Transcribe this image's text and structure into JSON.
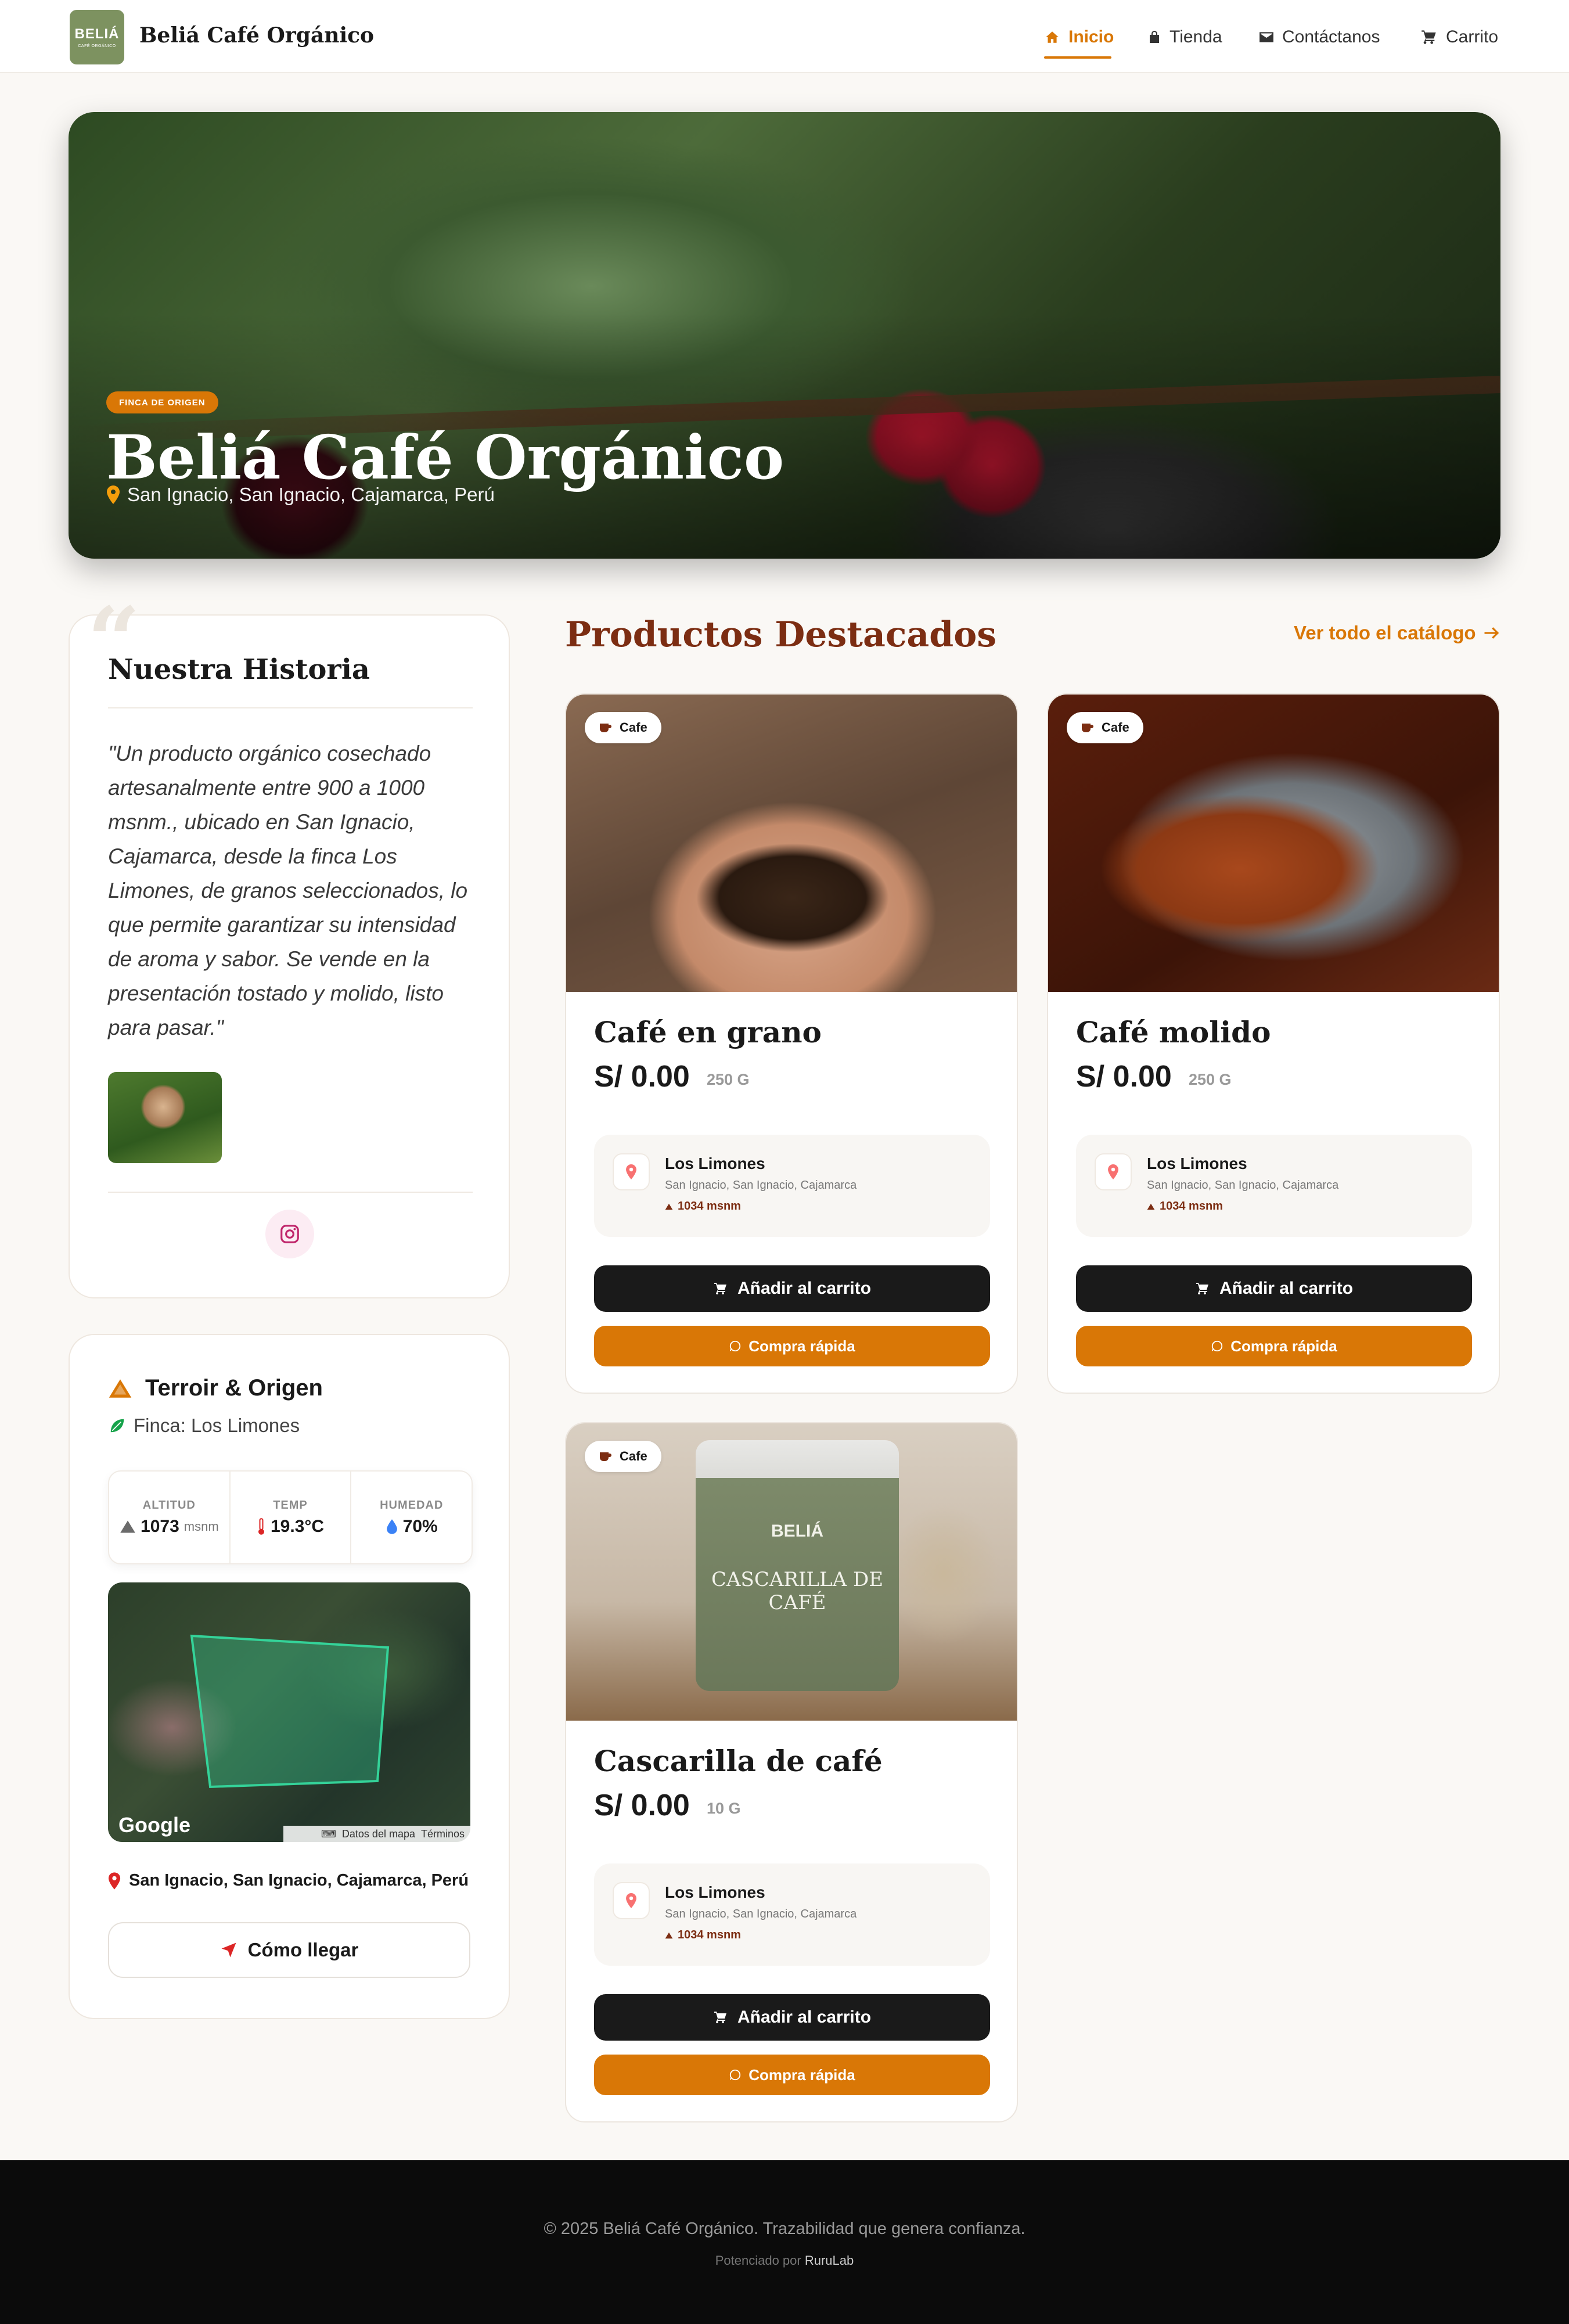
{
  "header": {
    "logo_text": "BELIÁ",
    "logo_sub": "CAFÉ ORGÁNICO",
    "brand": "Beliá Café Orgánico",
    "nav": [
      {
        "label": "Inicio",
        "icon": "home-icon",
        "active": true
      },
      {
        "label": "Tienda",
        "icon": "bag-icon",
        "active": false
      },
      {
        "label": "Contáctanos",
        "icon": "envelope-icon",
        "active": false
      },
      {
        "label": "Carrito",
        "icon": "cart-icon",
        "active": false
      }
    ]
  },
  "hero": {
    "badge": "FINCA DE ORIGEN",
    "title": "Beliá Café Orgánico",
    "location": "San Ignacio, San Ignacio, Cajamarca, Perú"
  },
  "story": {
    "title": "Nuestra Historia",
    "text": "\"Un producto orgánico cosechado artesanalmente entre 900 a 1000 msnm., ubicado en San Ignacio, Cajamarca, desde la finca Los Limones, de granos seleccionados, lo que permite garantizar su intensidad de aroma y sabor. Se vende en la presentación tostado y molido, listo para pasar.\"",
    "social_icon": "instagram-icon"
  },
  "terroir": {
    "title": "Terroir & Origen",
    "farm": "Finca: Los Limones",
    "stats": [
      {
        "label": "ALTITUD",
        "value": "1073",
        "unit": "msnm"
      },
      {
        "label": "TEMP",
        "value": "19.3°C",
        "unit": ""
      },
      {
        "label": "HUMEDAD",
        "value": "70%",
        "unit": ""
      }
    ],
    "map": {
      "logo": "Google",
      "attribution_data": "Datos del mapa",
      "attribution_terms": "Términos"
    },
    "address": "San Ignacio, San Ignacio, Cajamarca, Perú",
    "directions_label": "Cómo llegar"
  },
  "featured": {
    "title": "Productos Destacados",
    "catalog_link": "Ver todo el catálogo",
    "products": [
      {
        "category": "Cafe",
        "name": "Café en grano",
        "price": "S/ 0.00",
        "unit": "250 G",
        "farm": "Los Limones",
        "farm_location": "San Ignacio, San Ignacio, Cajamarca",
        "altitude": "1034 msnm",
        "cart_label": "Añadir al carrito",
        "quick_label": "Compra rápida"
      },
      {
        "category": "Cafe",
        "name": "Café molido",
        "price": "S/ 0.00",
        "unit": "250 G",
        "farm": "Los Limones",
        "farm_location": "San Ignacio, San Ignacio, Cajamarca",
        "altitude": "1034 msnm",
        "cart_label": "Añadir al carrito",
        "quick_label": "Compra rápida"
      },
      {
        "category": "Cafe",
        "name": "Cascarilla de café",
        "price": "S/ 0.00",
        "unit": "10 G",
        "farm": "Los Limones",
        "farm_location": "San Ignacio, San Ignacio, Cajamarca",
        "altitude": "1034 msnm",
        "cart_label": "Añadir al carrito",
        "quick_label": "Compra rápida",
        "package_brand": "BELIÁ",
        "package_title": "CASCARILLA DE CAFÉ"
      }
    ]
  },
  "footer": {
    "copyright": "© 2025 Beliá Café Orgánico. Trazabilidad que genera confianza.",
    "powered_prefix": "Potenciado por",
    "powered_by": "RuruLab"
  },
  "colors": {
    "accent": "#d97706",
    "brand_dark": "#7c2d12",
    "logo_green": "#7d9260",
    "button_dark": "#1a1a1a"
  }
}
